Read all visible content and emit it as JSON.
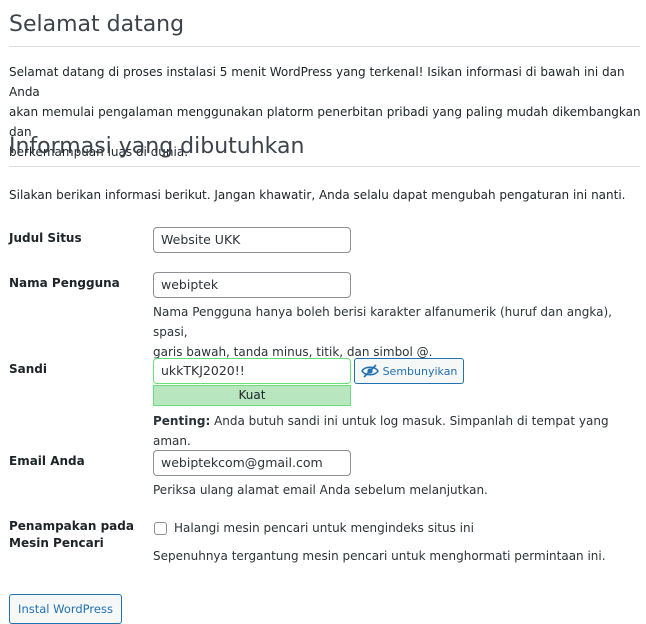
{
  "welcome": {
    "heading": "Selamat datang",
    "lines": [
      "Selamat datang di proses instalasi 5 menit WordPress yang terkenal! Isikan informasi di bawah ini dan Anda",
      "akan memulai pengalaman menggunakan platorm penerbitan pribadi yang paling mudah dikembangkan dan",
      "berkemampuan luas di dunia."
    ]
  },
  "info": {
    "heading": "Informasi yang dibutuhkan",
    "intro": "Silakan berikan informasi berikut. Jangan khawatir, Anda selalu dapat mengubah pengaturan ini nanti."
  },
  "form": {
    "site_title": {
      "label": "Judul Situs",
      "value": "Website UKK"
    },
    "username": {
      "label": "Nama Pengguna",
      "value": "webiptek",
      "hint_lines": [
        "Nama Pengguna hanya boleh berisi karakter alfanumerik (huruf dan angka), spasi,",
        "garis bawah, tanda minus, titik, dan simbol @."
      ]
    },
    "password": {
      "label": "Sandi",
      "value": "ukkTKJ2020!!",
      "hide_button": "Sembunyikan",
      "strength": "Kuat",
      "note_bold": "Penting:",
      "note_text": " Anda butuh sandi ini untuk log masuk. Simpanlah di tempat yang aman."
    },
    "email": {
      "label": "Email Anda",
      "value": "webiptekcom@gmail.com",
      "hint": "Periksa ulang alamat email Anda sebelum melanjutkan."
    },
    "visibility": {
      "label_lines": [
        "Penampakan pada",
        "Mesin Pencari"
      ],
      "checkbox_label": "Halangi mesin pencari untuk mengindeks situs ini",
      "checked": false,
      "hint": "Sepenuhnya tergantung mesin pencari untuk menghormati permintaan ini."
    }
  },
  "install_button": "Instal WordPress",
  "icons": {
    "hide_password": "eye-slash-icon"
  },
  "colors": {
    "accent": "#2271b1",
    "strength_bg": "#b8e6bf",
    "strength_border": "#68de7c"
  }
}
